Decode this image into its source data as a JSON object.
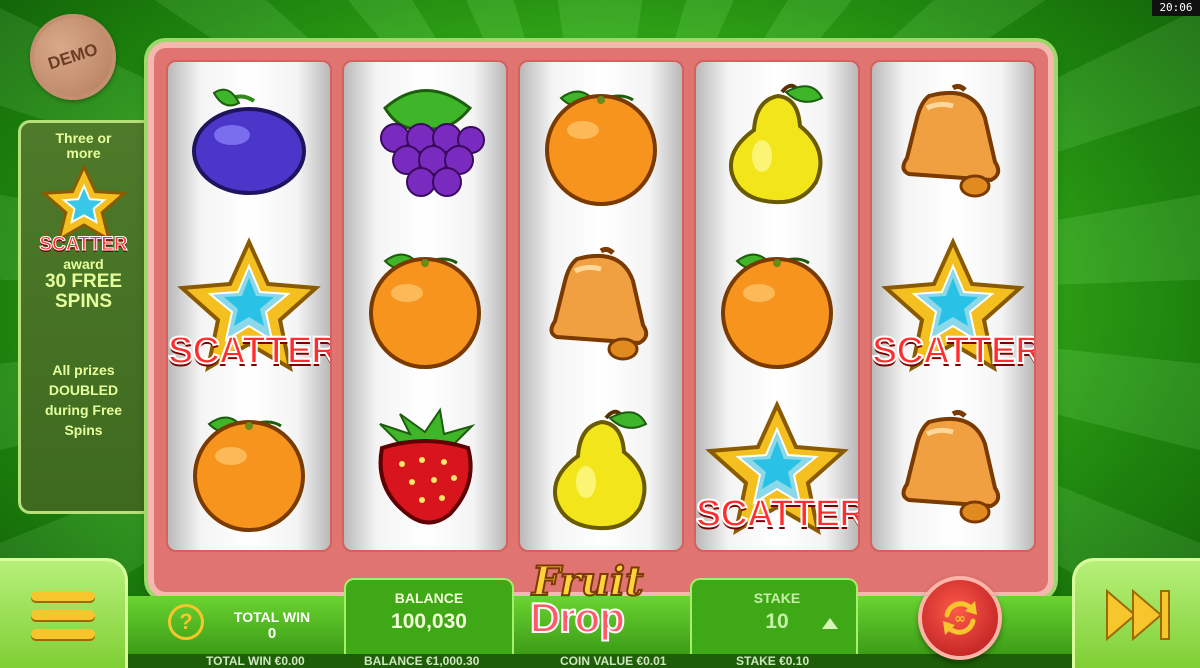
{
  "status": {
    "clock": "20:06"
  },
  "badge": {
    "demo": "DEMO"
  },
  "info_panel": {
    "line1": "Three or",
    "line2": "more",
    "scatter": "SCATTER",
    "award": "award",
    "free1": "30 FREE",
    "free2": "SPINS",
    "prize1": "All prizes",
    "prize2": "DOUBLED",
    "prize3": "during Free",
    "prize4": "Spins"
  },
  "reels": [
    [
      "plum",
      "scatter",
      "orange"
    ],
    [
      "grapes",
      "orange",
      "strawberry"
    ],
    [
      "orange",
      "bell",
      "pear"
    ],
    [
      "pear",
      "orange",
      "scatter"
    ],
    [
      "bell",
      "scatter",
      "bell"
    ]
  ],
  "scatter_label": "SCATTER",
  "controls": {
    "help": "?",
    "total_win_label": "TOTAL WIN",
    "total_win_value": "0",
    "balance_label": "BALANCE",
    "balance_value": "100,030",
    "stake_label": "STAKE",
    "stake_value": "10"
  },
  "logo": {
    "line1": "Fruit",
    "line2": "Drop"
  },
  "footer": {
    "total_win": "TOTAL WIN €0.00",
    "balance": "BALANCE €1,000.30",
    "coin_value": "COIN VALUE €0.01",
    "stake": "STAKE €0.10"
  },
  "colors": {
    "accent": "#f7c62c",
    "frame": "#e07470",
    "scatter": "#ff2d2d"
  }
}
